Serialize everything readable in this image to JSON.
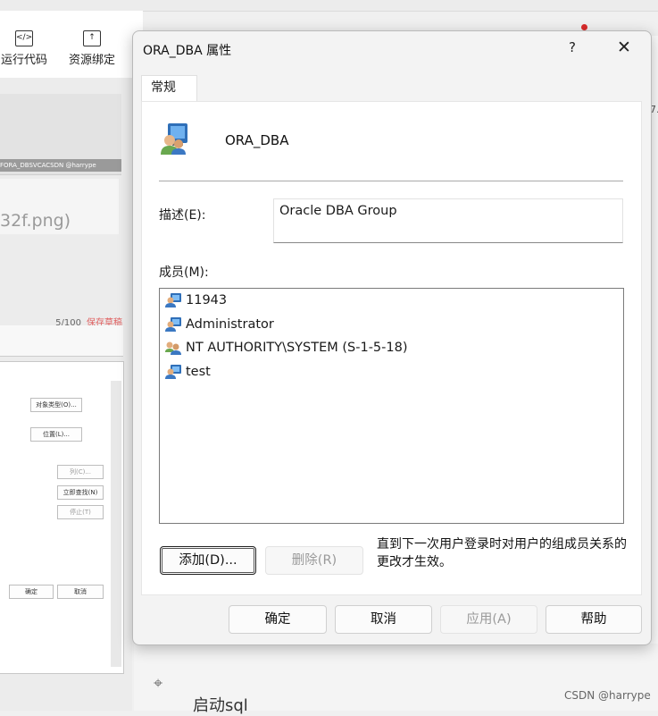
{
  "background": {
    "toolbar": {
      "run_code_label": "运行代码",
      "resource_bind_label": "资源绑定"
    },
    "thumbnail_caption": "FORA_DBSVCACSDN @harrype",
    "png_suffix": "32f.png)",
    "word_count": "5/100",
    "save_draft": "保存草稿",
    "old_dialog_buttons": [
      "对象类型(O)...",
      "位置(L)...",
      "列(C)...",
      "立即查找(N)",
      "停止(T)",
      "确定",
      "取消"
    ],
    "edge_number": "7.",
    "section_heading": "启动sql",
    "watermark": "CSDN @harrype"
  },
  "dialog": {
    "title": "ORA_DBA 属性",
    "help_glyph": "?",
    "close_glyph": "✕",
    "tabs": [
      {
        "label": "常规"
      }
    ],
    "group_name": "ORA_DBA",
    "description_label": "描述(E):",
    "description_value": "Oracle DBA Group",
    "members_label": "成员(M):",
    "members": [
      {
        "name": "11943",
        "icon": "user-icon"
      },
      {
        "name": "Administrator",
        "icon": "user-icon"
      },
      {
        "name": "NT AUTHORITY\\SYSTEM (S-1-5-18)",
        "icon": "group-icon"
      },
      {
        "name": "test",
        "icon": "user-icon"
      }
    ],
    "add_button": "添加(D)...",
    "remove_button": "删除(R)",
    "note": "直到下一次用户登录时对用户的组成员关系的更改才生效。",
    "ok_button": "确定",
    "cancel_button": "取消",
    "apply_button": "应用(A)",
    "help_button": "帮助"
  }
}
